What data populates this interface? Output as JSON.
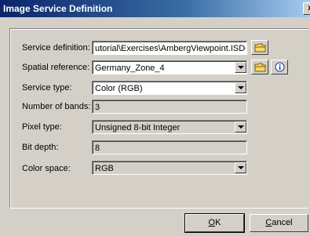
{
  "dialog": {
    "title": "Image Service Definition",
    "close_label": "x"
  },
  "fields": {
    "service_definition": {
      "label": "Service definition:",
      "value": "utorial\\Exercises\\AmbergViewpoint.ISDe"
    },
    "spatial_reference": {
      "label": "Spatial reference:",
      "value": "Germany_Zone_4"
    },
    "service_type": {
      "label": "Service type:",
      "value": "Color (RGB)"
    },
    "number_of_bands": {
      "label": "Number of bands:",
      "value": "3"
    },
    "pixel_type": {
      "label": "Pixel type:",
      "value": "Unsigned 8-bit Integer"
    },
    "bit_depth": {
      "label": "Bit depth:",
      "value": "8"
    },
    "color_space": {
      "label": "Color space:",
      "value": "RGB"
    }
  },
  "buttons": {
    "ok": {
      "label_first": "O",
      "label_rest": "K"
    },
    "cancel": {
      "label_first": "C",
      "label_rest": "ancel"
    }
  },
  "icons": {
    "browse": "folder-icon",
    "info": "info-icon"
  },
  "colors": {
    "titlebar_start": "#0a246a",
    "titlebar_end": "#a6caf0",
    "face": "#d4d0c8"
  }
}
